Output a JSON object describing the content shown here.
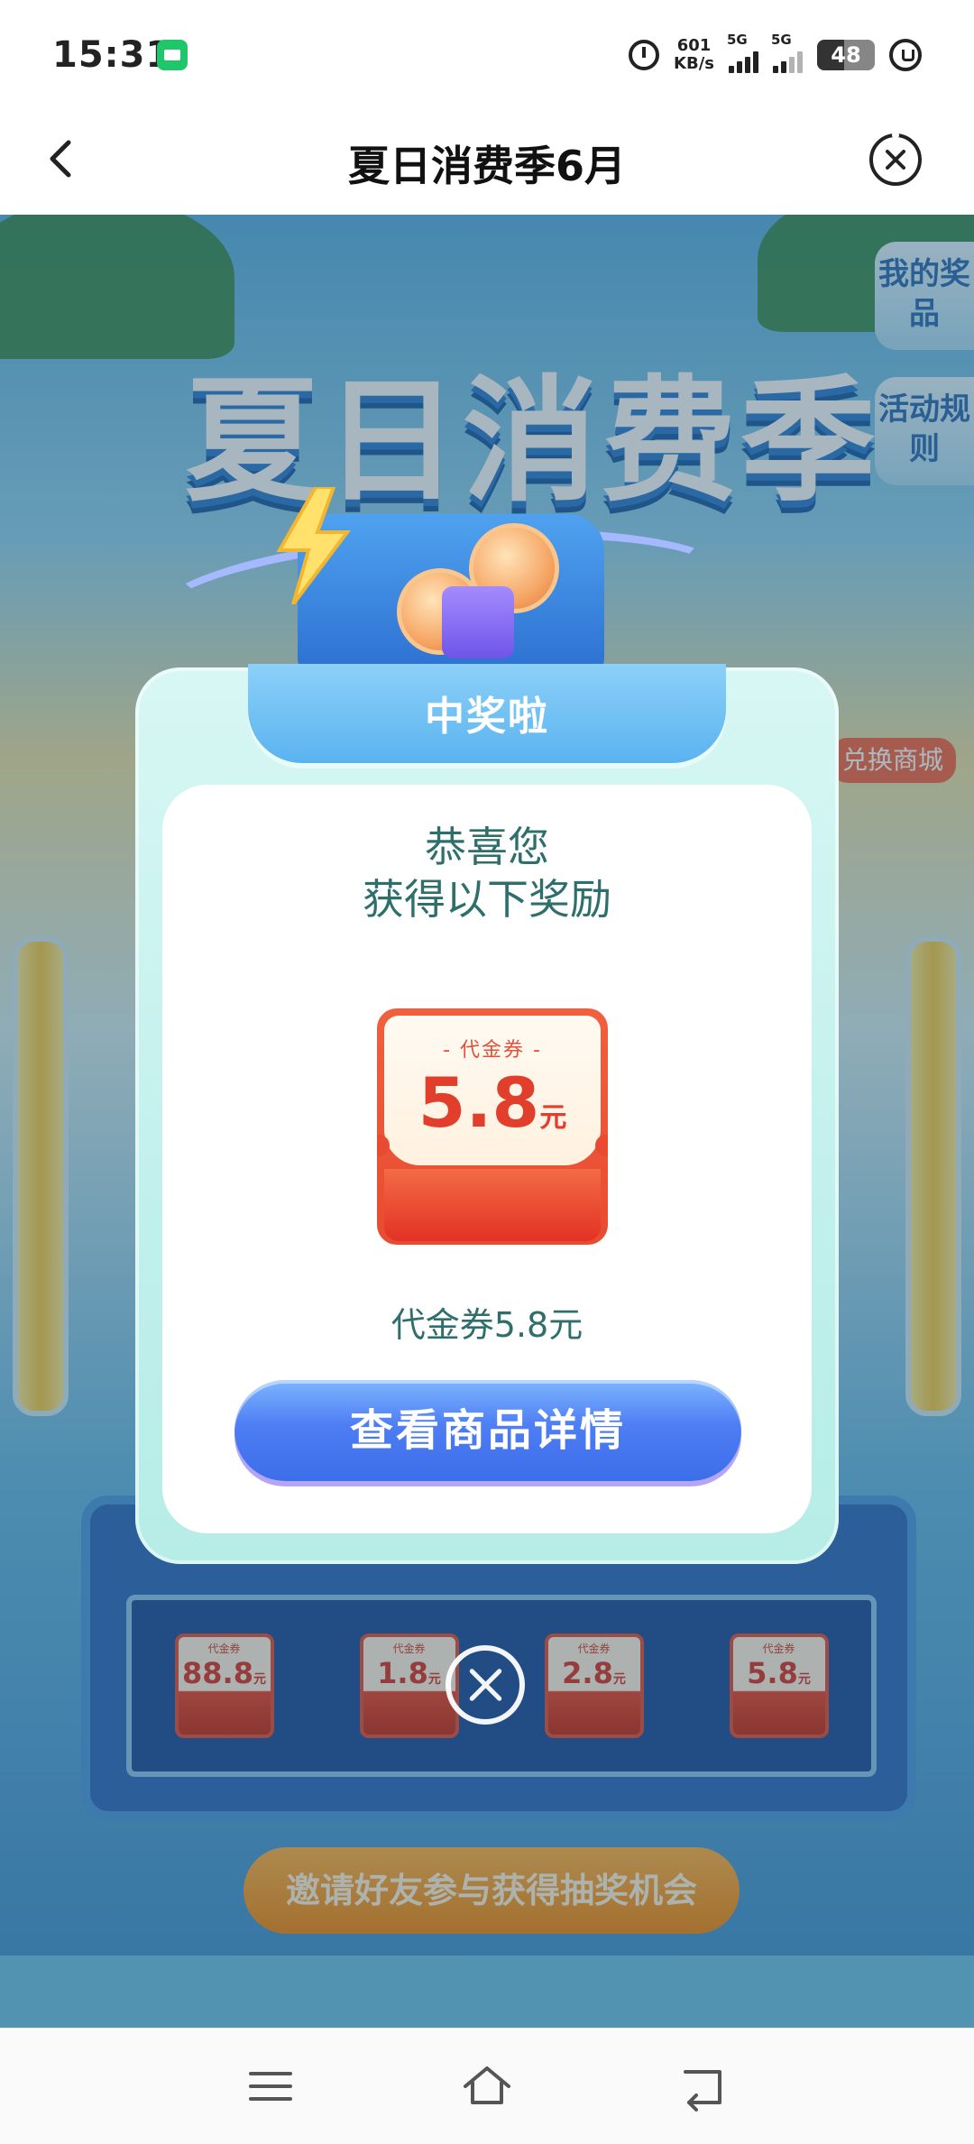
{
  "status_bar": {
    "time": "15:31",
    "net_speed_value": "601",
    "net_speed_unit": "KB/s",
    "sim1": "5G",
    "sim2": "5G",
    "battery": "48"
  },
  "titlebar": {
    "title": "夏日消费季6月"
  },
  "background": {
    "banner_title": "夏日消费季",
    "my_prizes": "我的奖品",
    "activity_rules": "活动规则",
    "exchange_mall": "兑换商城",
    "invite_button": "邀请好友参与获得抽奖机会",
    "mini_cards": [
      {
        "label": "代金券",
        "value": "88.8",
        "unit": "元"
      },
      {
        "label": "代金券",
        "value": "1.8",
        "unit": "元"
      },
      {
        "label": "代金券",
        "value": "2.8",
        "unit": "元"
      },
      {
        "label": "代金券",
        "value": "5.8",
        "unit": "元"
      }
    ]
  },
  "modal": {
    "heading": "中奖啦",
    "congrats_line1": "恭喜您",
    "congrats_line2": "获得以下奖励",
    "voucher_label": "- 代金券 -",
    "voucher_value": "5.8",
    "voucher_unit": "元",
    "prize_name": "代金券5.8元",
    "detail_button": "查看商品详情"
  },
  "colors": {
    "accent_teal": "#2e6f6c",
    "voucher_red": "#e23e2c",
    "button_blue": "#4e7df4"
  }
}
